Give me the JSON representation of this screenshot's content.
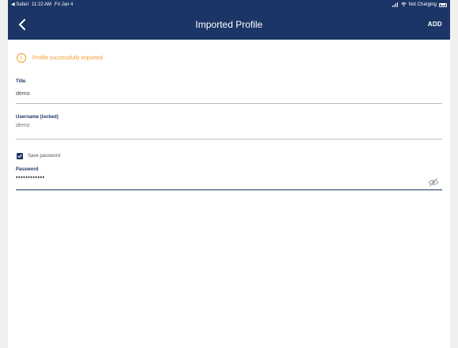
{
  "status_bar": {
    "back_app": "◀ Safari",
    "time": "11:22 AM",
    "date": "Fri Jan 4",
    "charging": "Not Charging"
  },
  "nav": {
    "title": "Imported Profile",
    "add_label": "ADD"
  },
  "notice": {
    "text": "Profile successfully imported",
    "color": "#f39b2e"
  },
  "form": {
    "title_label": "Title",
    "title_value": "demo",
    "username_label": "Username (locked)",
    "username_value": "demo",
    "save_password_label": "Save password",
    "save_password_checked": true,
    "password_label": "Password",
    "password_value": "••••••••••••"
  },
  "colors": {
    "header_bg": "#1b3666",
    "accent": "#1b3666",
    "warning": "#f39b2e"
  },
  "icons": {
    "back": "chevron-left-icon",
    "info": "info-circle-icon",
    "checkbox": "checkmark-icon",
    "password_visibility": "eye-slash-icon"
  }
}
